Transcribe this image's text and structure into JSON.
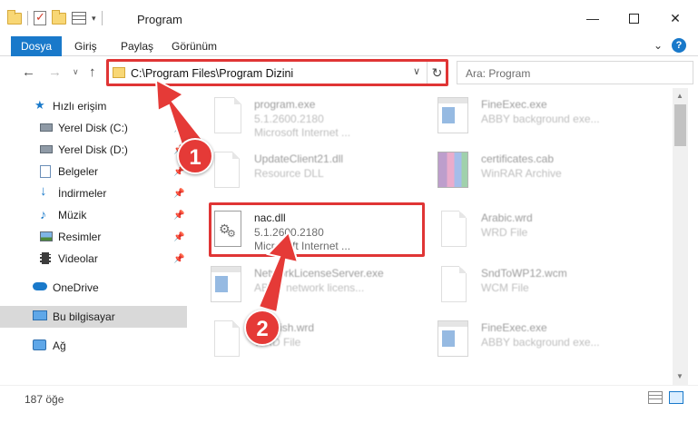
{
  "window": {
    "title": "Program",
    "min_symbol": "—",
    "close_symbol": "✕"
  },
  "ribbon": {
    "tabs": [
      "Dosya",
      "Giriş",
      "Paylaş",
      "Görünüm"
    ],
    "help": "?",
    "expand": "⌄"
  },
  "nav": {
    "back": "←",
    "forward": "→",
    "recent": "∨",
    "up": "↑",
    "address": "C:\\Program Files\\Program Dizini",
    "refresh": "↻",
    "address_drop": "∨",
    "search_placeholder": "Ara: Program"
  },
  "sidebar": {
    "items": [
      {
        "label": "Hızlı erişim",
        "icon": "star-icon"
      },
      {
        "label": "Yerel Disk (C:)",
        "icon": "drive-icon",
        "pinned": true
      },
      {
        "label": "Yerel Disk (D:)",
        "icon": "drive-icon",
        "pinned": true
      },
      {
        "label": "Belgeler",
        "icon": "documents-icon",
        "pinned": true
      },
      {
        "label": "İndirmeler",
        "icon": "download-icon",
        "pinned": true
      },
      {
        "label": "Müzik",
        "icon": "music-icon",
        "pinned": true
      },
      {
        "label": "Resimler",
        "icon": "pictures-icon",
        "pinned": true
      },
      {
        "label": "Videolar",
        "icon": "videos-icon",
        "pinned": true
      },
      {
        "label": "OneDrive",
        "icon": "cloud-icon"
      },
      {
        "label": "Bu bilgisayar",
        "icon": "computer-icon",
        "selected": true
      },
      {
        "label": "Ağ",
        "icon": "network-icon"
      }
    ]
  },
  "files": [
    {
      "name": "program.exe",
      "line1": "5.1.2600.2180",
      "line2": "Microsoft Internet ...",
      "icon": "exe-icon",
      "faded": true
    },
    {
      "name": "FineExec.exe",
      "line1": "ABBY background exe...",
      "line2": "",
      "icon": "app-window-icon",
      "faded": true
    },
    {
      "name": "UpdateClient21.dll",
      "line1": "Resource DLL",
      "line2": "",
      "icon": "document-icon",
      "faded": true
    },
    {
      "name": "certificates.cab",
      "line1": "WinRAR Archive",
      "line2": "",
      "icon": "archive-icon",
      "faded": true
    },
    {
      "name": "nac.dll",
      "line1": "5.1.2600.2180",
      "line2": "Microsoft Internet ...",
      "icon": "dll-gear-icon",
      "faded": false
    },
    {
      "name": "Arabic.wrd",
      "line1": "WRD File",
      "line2": "",
      "icon": "document-icon",
      "faded": true
    },
    {
      "name": "NetworkLicenseServer.exe",
      "line1": "ABBY network licens...",
      "line2": "",
      "icon": "app-window-icon",
      "faded": true
    },
    {
      "name": "SndToWP12.wcm",
      "line1": "WCM File",
      "line2": "",
      "icon": "document-icon",
      "faded": true
    },
    {
      "name": "Spanish.wrd",
      "line1": "WRD File",
      "line2": "",
      "icon": "document-icon",
      "faded": true
    },
    {
      "name": "FineExec.exe",
      "line1": "ABBY background exe...",
      "line2": "",
      "icon": "app-window-icon",
      "faded": true
    }
  ],
  "status": {
    "count": "187 öğe"
  },
  "annotations": {
    "step1": "1",
    "step2": "2",
    "accent": "#e03535"
  },
  "colors": {
    "file_tab": "#1979ca",
    "selected_sidebar": "#d9d9d9"
  }
}
